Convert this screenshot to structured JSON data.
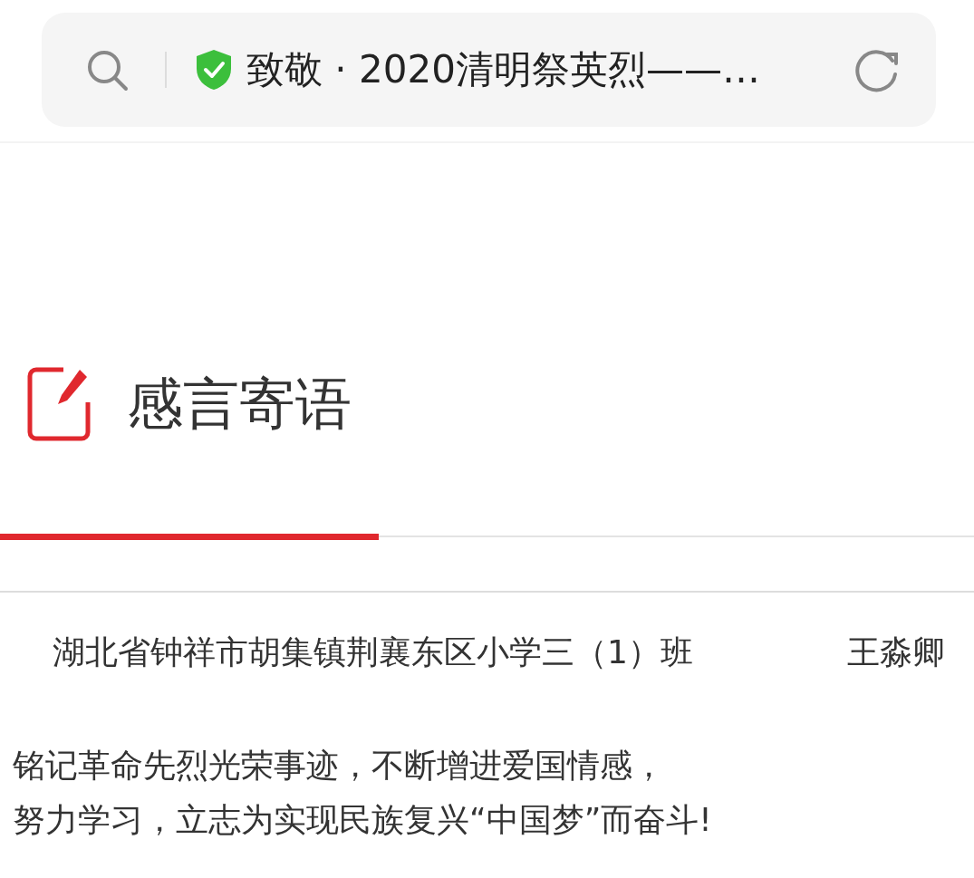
{
  "address_bar": {
    "title": "致敬 · 2020清明祭英烈——…"
  },
  "section": {
    "title": "感言寄语"
  },
  "message": {
    "school": "湖北省钟祥市胡集镇荆襄东区小学三（1）班",
    "name": "王淼卿",
    "lines": [
      "铭记革命先烈光荣事迹，不断增进爱国情感，",
      "努力学习，立志为实现民族复兴“中国梦”而奋斗!"
    ]
  }
}
